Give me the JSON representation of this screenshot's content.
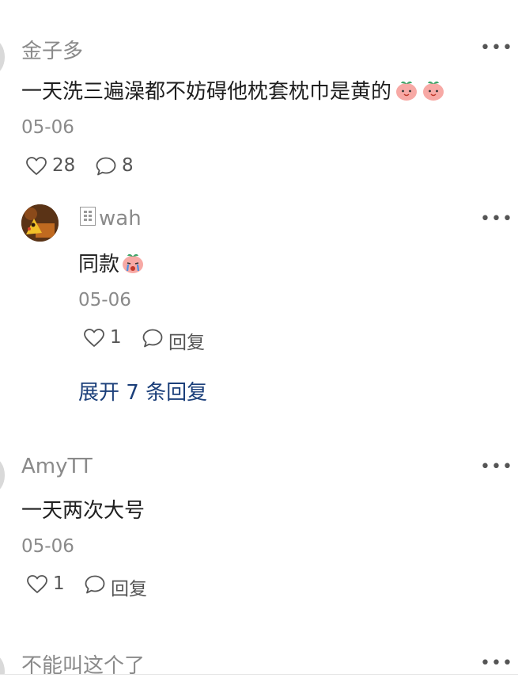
{
  "comments": [
    {
      "username": "金子多",
      "text": "一天洗三遍澡都不妨碍他枕套枕巾是黄的",
      "emojis": [
        "peach-emoji",
        "peach-emoji"
      ],
      "date": "05-06",
      "likes": "28",
      "reply_count": "8"
    },
    {
      "username": "wah",
      "text": "同款",
      "emoji": "crying-peach-emoji",
      "date": "05-06",
      "likes": "1",
      "reply_label": "回复",
      "expand_label": "展开 7 条回复"
    },
    {
      "username": "AmyTT",
      "text": "一天两次大号",
      "date": "05-06",
      "likes": "1",
      "reply_label": "回复"
    },
    {
      "username": "不能叫这个了"
    }
  ],
  "colors": {
    "name_gray": "#8a8a8a",
    "link_blue": "#1b3f7a",
    "emoji_pink": "#f7a9a5",
    "leaf_green": "#3fa66a"
  },
  "icons": [
    "heart-icon",
    "comment-icon",
    "more-icon"
  ]
}
